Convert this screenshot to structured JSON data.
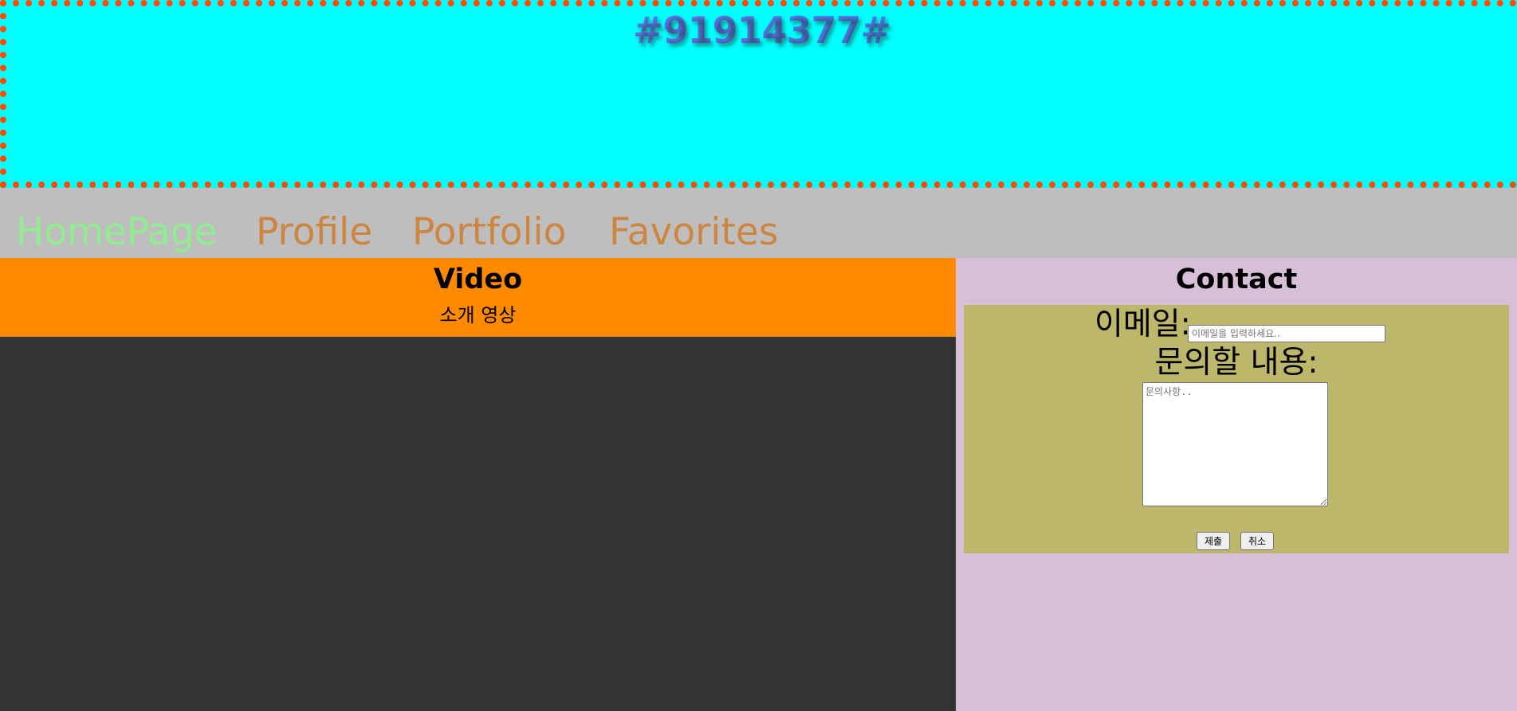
{
  "header": {
    "title": "#91914377#"
  },
  "nav": {
    "items": [
      {
        "label": "HomePage",
        "active": true
      },
      {
        "label": "Profile",
        "active": false
      },
      {
        "label": "Portfolio",
        "active": false
      },
      {
        "label": "Favorites",
        "active": false
      }
    ]
  },
  "video": {
    "title": "Video",
    "subtitle": "소개 영상"
  },
  "contact": {
    "title": "Contact",
    "email_label": "이메일:",
    "email_placeholder": "이메일을 입력하세요..",
    "email_value": "",
    "message_label": "문의할 내용:",
    "message_placeholder": "문의사항..",
    "message_value": "",
    "submit_label": "제출",
    "cancel_label": "취소"
  },
  "colors": {
    "header_bg": "#00ffff",
    "header_border": "#ff4a00",
    "nav_bg": "#bebebe",
    "nav_active": "#90ee90",
    "nav_link": "#cd853f",
    "video_head_bg": "#ff8a00",
    "video_area_bg": "#333333",
    "contact_bg": "#d8bfd8",
    "form_bg": "#bdb76b"
  }
}
